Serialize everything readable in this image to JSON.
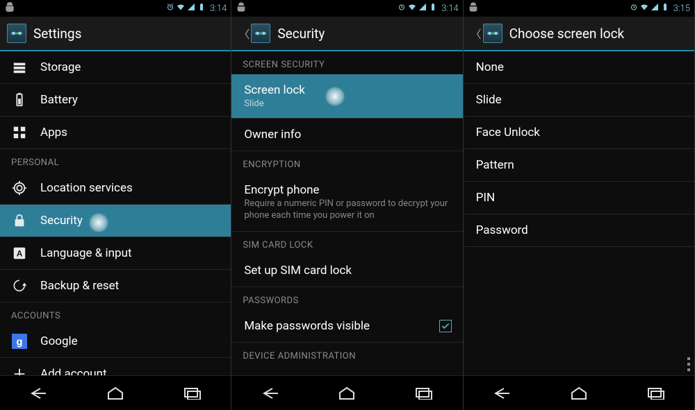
{
  "status": {
    "time_a": "3:14",
    "time_b": "3:14",
    "time_c": "3:15"
  },
  "panel1": {
    "title": "Settings",
    "items": [
      {
        "label": "Storage",
        "icon": "storage-icon"
      },
      {
        "label": "Battery",
        "icon": "battery-icon"
      },
      {
        "label": "Apps",
        "icon": "apps-icon"
      }
    ],
    "section_personal": "PERSONAL",
    "personal": [
      {
        "label": "Location services",
        "icon": "location-icon"
      },
      {
        "label": "Security",
        "icon": "lock-icon",
        "selected": true
      },
      {
        "label": "Language & input",
        "icon": "language-icon"
      },
      {
        "label": "Backup & reset",
        "icon": "backup-icon"
      }
    ],
    "section_accounts": "ACCOUNTS",
    "accounts": [
      {
        "label": "Google",
        "icon": "google-icon"
      },
      {
        "label": "Add account",
        "icon": "plus-icon"
      }
    ]
  },
  "panel2": {
    "title": "Security",
    "section_screen": "SCREEN SECURITY",
    "screen_lock": {
      "label": "Screen lock",
      "value": "Slide",
      "selected": true
    },
    "owner_info": {
      "label": "Owner info"
    },
    "section_encryption": "ENCRYPTION",
    "encrypt": {
      "label": "Encrypt phone",
      "desc": "Require a numeric PIN or password to decrypt your phone each time you power it on"
    },
    "section_sim": "SIM CARD LOCK",
    "sim": {
      "label": "Set up SIM card lock"
    },
    "section_passwords": "PASSWORDS",
    "pw_visible": {
      "label": "Make passwords visible",
      "checked": true
    },
    "section_device_admin": "DEVICE ADMINISTRATION"
  },
  "panel3": {
    "title": "Choose screen lock",
    "options": [
      "None",
      "Slide",
      "Face Unlock",
      "Pattern",
      "PIN",
      "Password"
    ]
  }
}
